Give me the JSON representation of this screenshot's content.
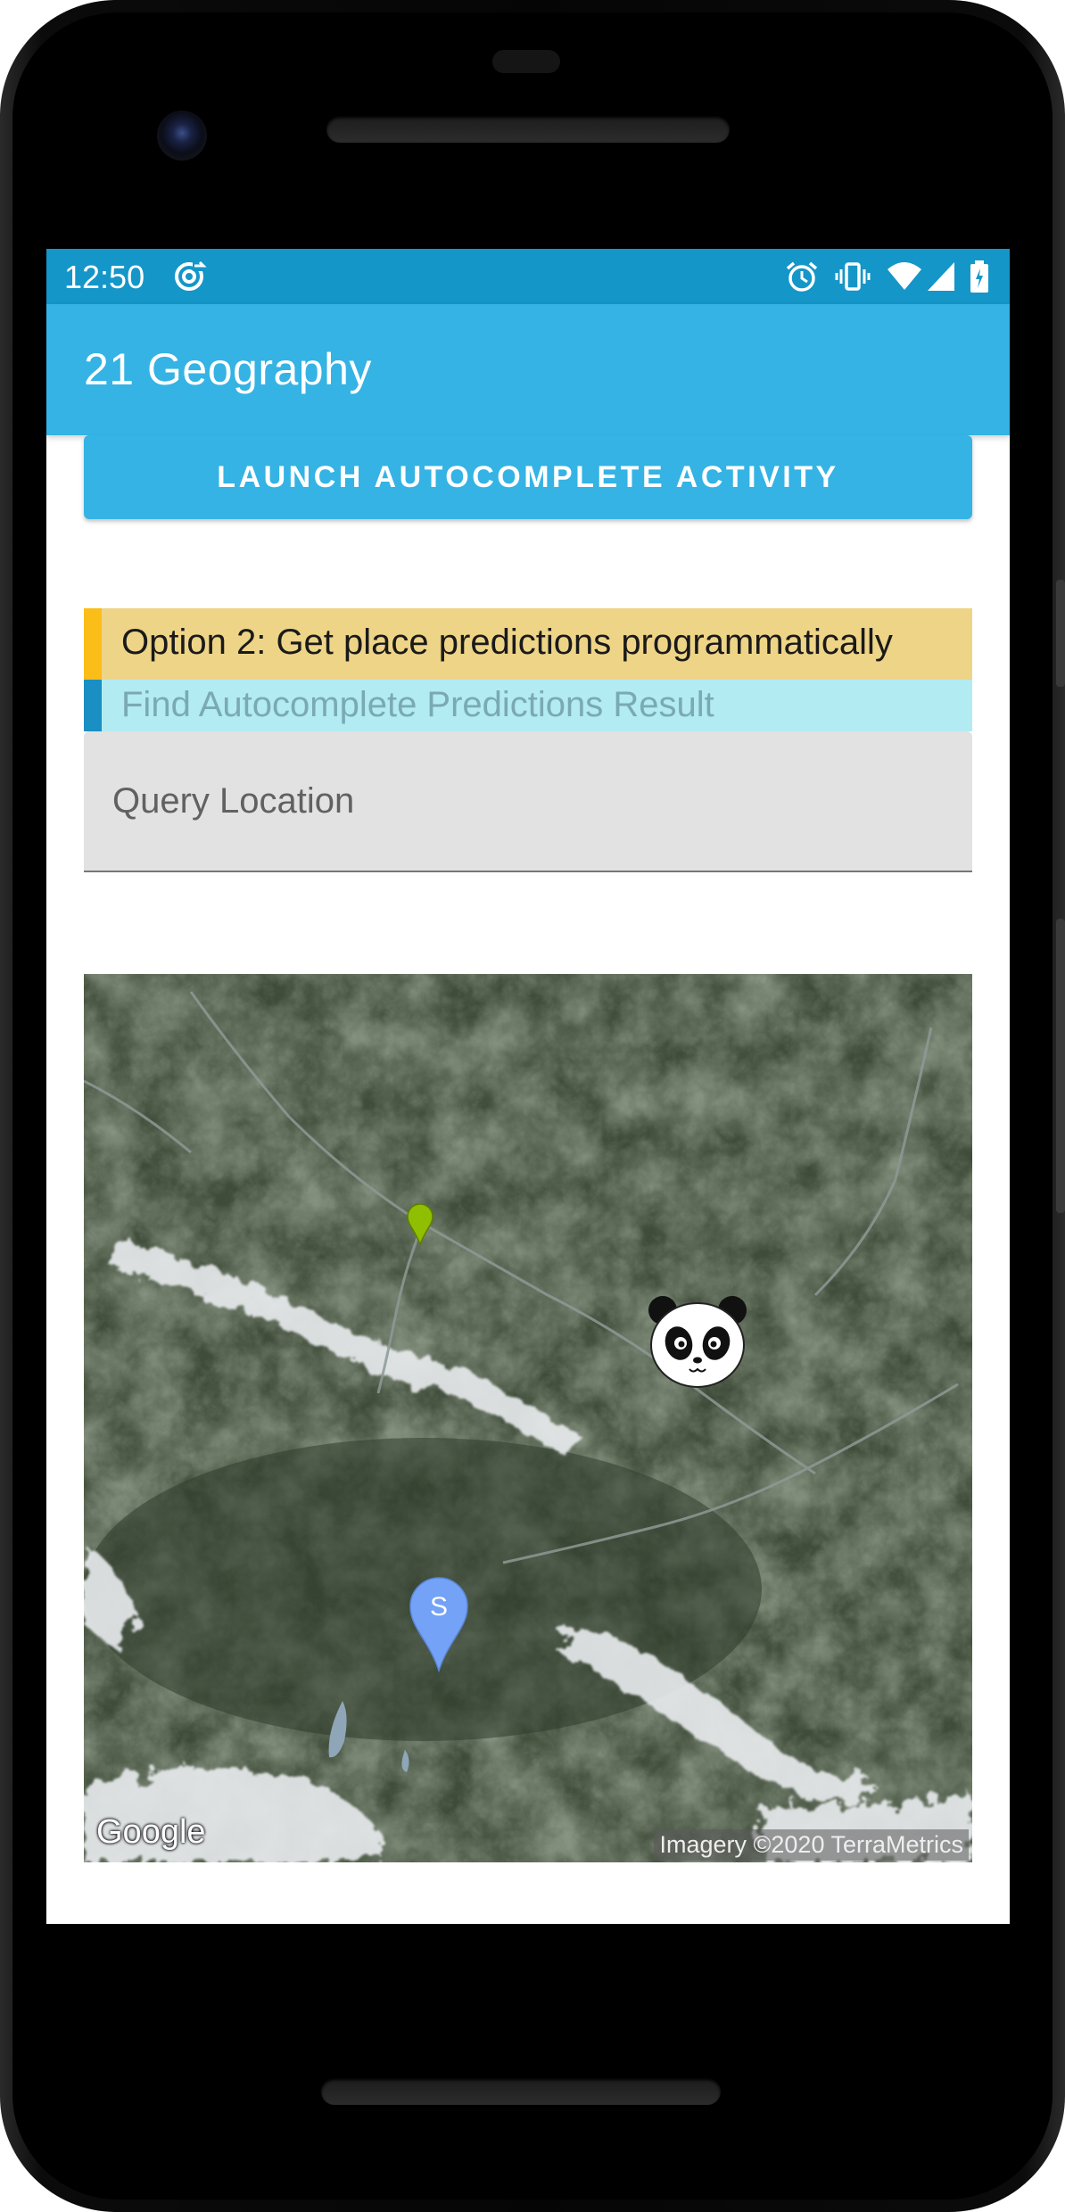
{
  "status_bar": {
    "time": "12:50",
    "icons": [
      "sync-icon",
      "alarm-icon",
      "vibrate-icon",
      "wifi-icon",
      "signal-icon",
      "battery-icon"
    ],
    "color": "#1596c8"
  },
  "app_bar": {
    "title": "21 Geography",
    "color": "#34b3e4"
  },
  "launch_button": {
    "label": "LAUNCH AUTOCOMPLETE ACTIVITY"
  },
  "option_section": {
    "header": "Option 2: Get place predictions programmatically",
    "result_label": "Find Autocomplete Predictions Result",
    "header_color": "#eed487",
    "header_accent": "#fbbd18",
    "result_color": "#b2ebf2",
    "result_accent": "#1a8fc4"
  },
  "query_field": {
    "placeholder": "Query Location",
    "value": ""
  },
  "map": {
    "type": "satellite",
    "logo": "Google",
    "attribution": "Imagery ©2020 TerraMetrics",
    "markers": [
      {
        "name": "green-marker",
        "color": "#8fbf00",
        "label": ""
      },
      {
        "name": "panda-marker",
        "icon": "panda-icon",
        "label": ""
      },
      {
        "name": "blue-marker",
        "color": "#73a2f7",
        "label": "S"
      }
    ]
  }
}
